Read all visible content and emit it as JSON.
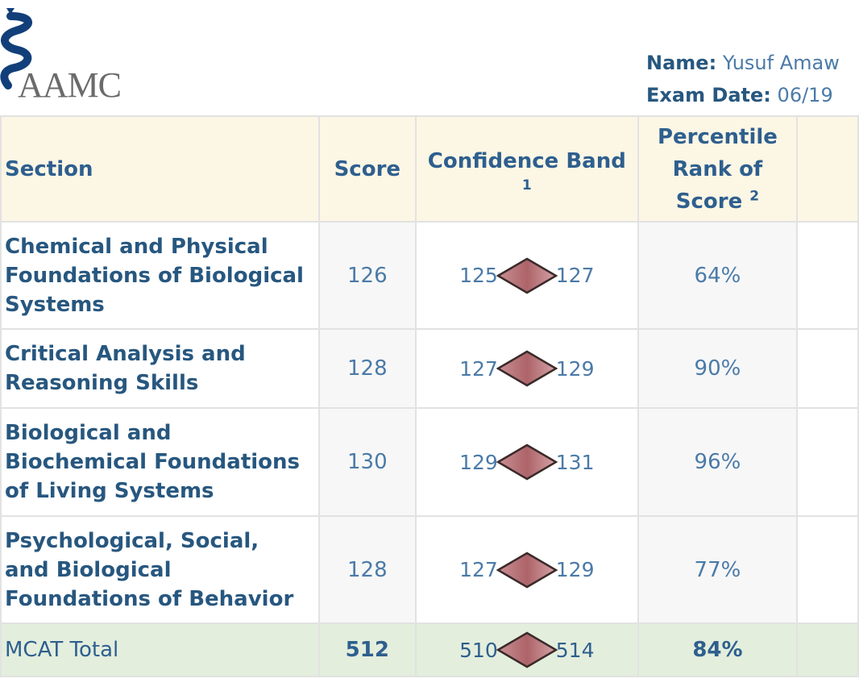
{
  "header": {
    "logo_text": "AAMC",
    "name_label": "Name:",
    "name_value": "Yusuf Amaw",
    "exam_date_label": "Exam Date:",
    "exam_date_value": "06/19"
  },
  "table": {
    "columns": {
      "section": "Section",
      "score": "Score",
      "band": "Confidence Band",
      "band_footnote": "1",
      "percentile_l1": "Percentile",
      "percentile_l2": "Rank of",
      "percentile_l3": "Score",
      "percentile_footnote": "2"
    },
    "rows": [
      {
        "section_lines": [
          "Chemical and Physical",
          "Foundations of Biological",
          "Systems"
        ],
        "score": "126",
        "band_low": "125",
        "band_high": "127",
        "percentile": "64%"
      },
      {
        "section_lines": [
          "Critical Analysis and",
          "Reasoning Skills"
        ],
        "score": "128",
        "band_low": "127",
        "band_high": "129",
        "percentile": "90%"
      },
      {
        "section_lines": [
          "Biological and",
          "Biochemical Foundations",
          "of Living Systems"
        ],
        "score": "130",
        "band_low": "129",
        "band_high": "131",
        "percentile": "96%"
      },
      {
        "section_lines": [
          "Psychological, Social,",
          "and Biological",
          "Foundations of Behavior"
        ],
        "score": "128",
        "band_low": "127",
        "band_high": "129",
        "percentile": "77%"
      }
    ],
    "total": {
      "section": "MCAT Total",
      "score": "512",
      "band_low": "510",
      "band_high": "514",
      "percentile": "84%"
    }
  },
  "colors": {
    "header_bg": "#fcf6e5",
    "total_bg": "#e3eedd",
    "text_blue": "#2e5f8e",
    "diamond_fill": "#b9757a"
  }
}
